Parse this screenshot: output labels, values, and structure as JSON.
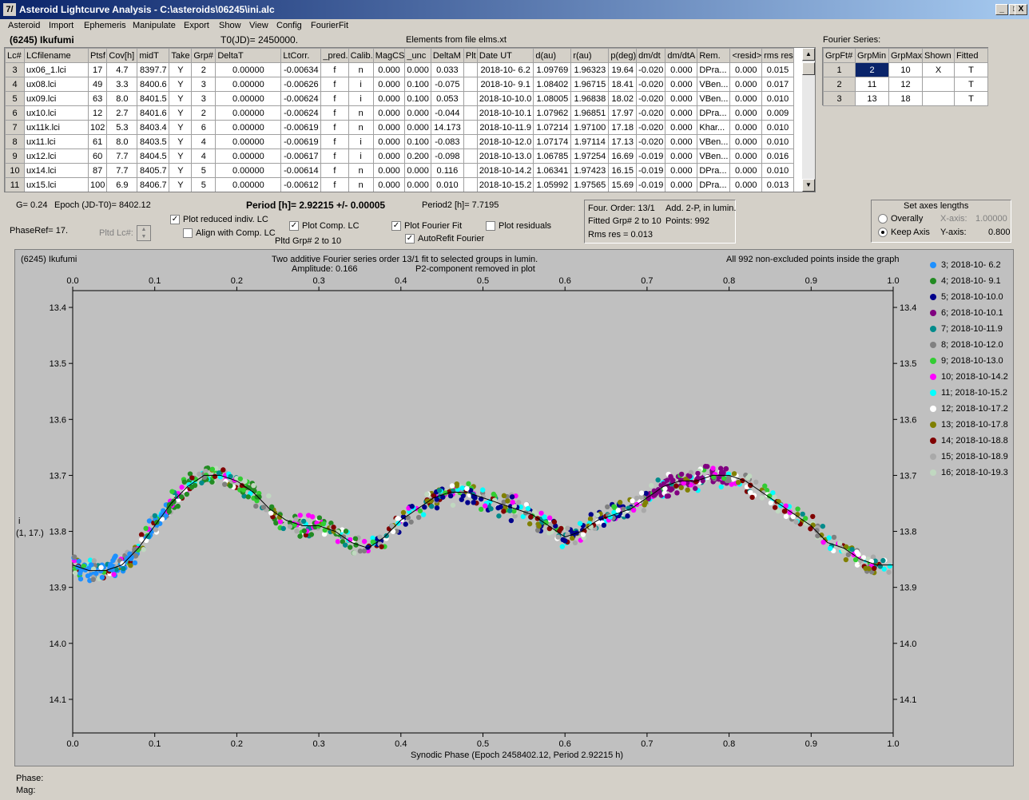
{
  "window": {
    "title": "Asteroid Lightcurve Analysis - C:\\asteroids\\06245\\ini.alc",
    "icon_text": "7/",
    "min": "_",
    "max": "□",
    "close": "X"
  },
  "menu": [
    "Asteroid",
    "Import",
    "Ephemeris",
    "Manipulate",
    "Export",
    "Show",
    "View",
    "Config",
    "FourierFit"
  ],
  "header": {
    "asteroid": "(6245) Ikufumi",
    "t0": "T0(JD)= 2450000.",
    "elements": "Elements from file elms.xt"
  },
  "grid": {
    "columns": [
      "Lc#",
      "LCfilename",
      "Ptsf",
      "Cov[h]",
      "midT",
      "Take",
      "Grp#",
      "DeltaT",
      "LtCorr.",
      "_pred.",
      "Calib.",
      "MagCS",
      "_unc",
      "DeltaM",
      "Plt",
      "Date UT",
      "d(au)",
      "r(au)",
      "p(deg)",
      "dm/dt",
      "dm/dtA",
      "Rem.",
      "<resid>",
      "rms res"
    ],
    "rows": [
      [
        "3",
        "ux06_1.lci",
        "17",
        "4.7",
        "8397.7",
        "Y",
        "2",
        "0.00000",
        "-0.00634",
        "f",
        "n",
        "0.000",
        "0.000",
        "0.033",
        "",
        "2018-10- 6.2",
        "1.09769",
        "1.96323",
        "19.64",
        "-0.020",
        "0.000",
        "DPra...",
        "0.000",
        "0.015"
      ],
      [
        "4",
        "ux08.lci",
        "49",
        "3.3",
        "8400.6",
        "Y",
        "3",
        "0.00000",
        "-0.00626",
        "f",
        "i",
        "0.000",
        "0.100",
        "-0.075",
        "",
        "2018-10- 9.1",
        "1.08402",
        "1.96715",
        "18.41",
        "-0.020",
        "0.000",
        "VBen...",
        "0.000",
        "0.017"
      ],
      [
        "5",
        "ux09.lci",
        "63",
        "8.0",
        "8401.5",
        "Y",
        "3",
        "0.00000",
        "-0.00624",
        "f",
        "i",
        "0.000",
        "0.100",
        "0.053",
        "",
        "2018-10-10.0",
        "1.08005",
        "1.96838",
        "18.02",
        "-0.020",
        "0.000",
        "VBen...",
        "0.000",
        "0.010"
      ],
      [
        "6",
        "ux10.lci",
        "12",
        "2.7",
        "8401.6",
        "Y",
        "2",
        "0.00000",
        "-0.00624",
        "f",
        "n",
        "0.000",
        "0.000",
        "-0.044",
        "",
        "2018-10-10.1",
        "1.07962",
        "1.96851",
        "17.97",
        "-0.020",
        "0.000",
        "DPra...",
        "0.000",
        "0.009"
      ],
      [
        "7",
        "ux11k.lci",
        "102",
        "5.3",
        "8403.4",
        "Y",
        "6",
        "0.00000",
        "-0.00619",
        "f",
        "n",
        "0.000",
        "0.000",
        "14.173",
        "",
        "2018-10-11.9",
        "1.07214",
        "1.97100",
        "17.18",
        "-0.020",
        "0.000",
        "Khar...",
        "0.000",
        "0.010"
      ],
      [
        "8",
        "ux11.lci",
        "61",
        "8.0",
        "8403.5",
        "Y",
        "4",
        "0.00000",
        "-0.00619",
        "f",
        "i",
        "0.000",
        "0.100",
        "-0.083",
        "",
        "2018-10-12.0",
        "1.07174",
        "1.97114",
        "17.13",
        "-0.020",
        "0.000",
        "VBen...",
        "0.000",
        "0.010"
      ],
      [
        "9",
        "ux12.lci",
        "60",
        "7.7",
        "8404.5",
        "Y",
        "4",
        "0.00000",
        "-0.00617",
        "f",
        "i",
        "0.000",
        "0.200",
        "-0.098",
        "",
        "2018-10-13.0",
        "1.06785",
        "1.97254",
        "16.69",
        "-0.019",
        "0.000",
        "VBen...",
        "0.000",
        "0.016"
      ],
      [
        "10",
        "ux14.lci",
        "87",
        "7.7",
        "8405.7",
        "Y",
        "5",
        "0.00000",
        "-0.00614",
        "f",
        "n",
        "0.000",
        "0.000",
        "0.116",
        "",
        "2018-10-14.2",
        "1.06341",
        "1.97423",
        "16.15",
        "-0.019",
        "0.000",
        "DPra...",
        "0.000",
        "0.010"
      ],
      [
        "11",
        "ux15.lci",
        "100",
        "6.9",
        "8406.7",
        "Y",
        "5",
        "0.00000",
        "-0.00612",
        "f",
        "n",
        "0.000",
        "0.000",
        "0.010",
        "",
        "2018-10-15.2",
        "1.05992",
        "1.97565",
        "15.69",
        "-0.019",
        "0.000",
        "DPra...",
        "0.000",
        "0.013"
      ]
    ]
  },
  "fourier": {
    "title": "Fourier Series:",
    "columns": [
      "GrpFt#",
      "GrpMin",
      "GrpMax",
      "Shown",
      "Fitted"
    ],
    "rows": [
      [
        "1",
        "2",
        "10",
        "X",
        "T"
      ],
      [
        "2",
        "11",
        "12",
        "",
        "T"
      ],
      [
        "3",
        "13",
        "18",
        "",
        "T"
      ]
    ]
  },
  "controls": {
    "g": "G= 0.24",
    "epoch": "Epoch (JD-T0)= 8402.12",
    "phase_ref": "PhaseRef= 17.",
    "pltd_lc": "Pltd Lc#:",
    "period": "Period [h]= 2.92215 +/- 0.00005",
    "period2": "Period2 [h]= 7.7195",
    "plot_reduced": "Plot reduced indiv. LC",
    "align": "Align with Comp. LC",
    "plot_comp": "Plot Comp. LC",
    "pltd_grp": "Pltd Grp#  2   to   10",
    "plot_fourier": "Plot Fourier Fit",
    "autorefit": "AutoRefit Fourier",
    "plot_residuals": "Plot residuals",
    "plot_reduced_checked": true,
    "align_checked": false,
    "plot_comp_checked": true,
    "plot_fourier_checked": true,
    "autorefit_checked": true,
    "plot_residuals_checked": false,
    "info1": "Four. Order: 13/1",
    "info2": "Add. 2-P, in lumin.",
    "info3": "Fitted Grp# 2 to 10",
    "info4": "Points: 992",
    "info5": "Rms res     = 0.013",
    "axes_title": "Set axes lengths",
    "overally": "Overally",
    "keep_axis": "Keep Axis",
    "xaxis_lbl": "X-axis:",
    "xaxis_val": "1.00000",
    "yaxis_lbl": "Y-axis:",
    "yaxis_val": "0.800",
    "keep_axis_selected": true
  },
  "plot": {
    "name": "(6245) Ikufumi",
    "line1": "Two additive Fourier series order 13/1 fit to selected groups in lumin.",
    "amp": "Amplitude: 0.166",
    "p2": "P2-component removed in plot",
    "allpts": "All 992 non-excluded points inside the graph",
    "ylabel1": "i",
    "ylabel2": "(1, 17.)",
    "xlabel": "Synodic Phase (Epoch 2458402.12, Period 2.92215 h)"
  },
  "footer": {
    "phase": "Phase:",
    "mag": "Mag:"
  },
  "chart_data": {
    "type": "scatter",
    "title": "Two additive Fourier series order 13/1 fit to selected groups in lumin.",
    "xlabel": "Synodic Phase (Epoch 2458402.12, Period 2.92215 h)",
    "ylabel": "i",
    "xlim": [
      0,
      1
    ],
    "ylim": [
      14.2,
      13.35
    ],
    "xticks": [
      "0.0",
      "0.1",
      "0.2",
      "0.3",
      "0.4",
      "0.5",
      "0.6",
      "0.7",
      "0.8",
      "0.9",
      "1.0"
    ],
    "yticks": [
      "13.4",
      "13.5",
      "13.6",
      "13.7",
      "13.8",
      "13.9",
      "14.0",
      "14.1"
    ],
    "fit_curve": {
      "x": [
        0,
        0.02,
        0.04,
        0.06,
        0.08,
        0.1,
        0.12,
        0.14,
        0.16,
        0.18,
        0.2,
        0.22,
        0.24,
        0.26,
        0.28,
        0.3,
        0.32,
        0.34,
        0.36,
        0.38,
        0.4,
        0.42,
        0.44,
        0.46,
        0.48,
        0.5,
        0.52,
        0.54,
        0.56,
        0.58,
        0.6,
        0.62,
        0.64,
        0.66,
        0.68,
        0.7,
        0.72,
        0.74,
        0.76,
        0.78,
        0.8,
        0.82,
        0.84,
        0.86,
        0.88,
        0.9,
        0.92,
        0.94,
        0.96,
        0.98,
        1.0
      ],
      "y": [
        13.86,
        13.87,
        13.87,
        13.86,
        13.83,
        13.79,
        13.75,
        13.72,
        13.7,
        13.7,
        13.71,
        13.73,
        13.76,
        13.78,
        13.79,
        13.79,
        13.8,
        13.82,
        13.83,
        13.81,
        13.78,
        13.76,
        13.74,
        13.73,
        13.73,
        13.74,
        13.75,
        13.76,
        13.77,
        13.79,
        13.81,
        13.8,
        13.78,
        13.77,
        13.76,
        13.74,
        13.72,
        13.71,
        13.71,
        13.7,
        13.7,
        13.71,
        13.73,
        13.75,
        13.77,
        13.79,
        13.82,
        13.83,
        13.85,
        13.86,
        13.86
      ]
    },
    "series": [
      {
        "name": "3; 2018-10- 6.2",
        "color": "#1e90ff",
        "phase_range": [
          0.0,
          0.12
        ]
      },
      {
        "name": "4; 2018-10- 9.1",
        "color": "#228b22",
        "phase_range": [
          0.1,
          0.35
        ]
      },
      {
        "name": "5; 2018-10-10.0",
        "color": "#00008b",
        "phase_range": [
          0.35,
          0.7
        ]
      },
      {
        "name": "6; 2018-10-10.1",
        "color": "#800080",
        "phase_range": [
          0.7,
          0.8
        ]
      },
      {
        "name": "7; 2018-10-11.9",
        "color": "#008b8b",
        "phase_range": [
          0.0,
          1.0
        ]
      },
      {
        "name": "8; 2018-10-12.0",
        "color": "#808080",
        "phase_range": [
          0.0,
          1.0
        ]
      },
      {
        "name": "9; 2018-10-13.0",
        "color": "#32cd32",
        "phase_range": [
          0.0,
          1.0
        ]
      },
      {
        "name": "10; 2018-10-14.2",
        "color": "#ff00ff",
        "phase_range": [
          0.0,
          1.0
        ]
      },
      {
        "name": "11; 2018-10-15.2",
        "color": "#00ffff",
        "phase_range": [
          0.0,
          1.0
        ]
      },
      {
        "name": "12; 2018-10-17.2",
        "color": "#ffffff",
        "phase_range": [
          0.0,
          1.0
        ]
      },
      {
        "name": "13; 2018-10-17.8",
        "color": "#808000",
        "phase_range": [
          0.0,
          1.0
        ]
      },
      {
        "name": "14; 2018-10-18.8",
        "color": "#800000",
        "phase_range": [
          0.0,
          1.0
        ]
      },
      {
        "name": "15; 2018-10-18.9",
        "color": "#a9a9a9",
        "phase_range": [
          0.0,
          1.0
        ]
      },
      {
        "name": "16; 2018-10-19.3",
        "color": "#c0d8c0",
        "phase_range": [
          0.0,
          1.0
        ]
      }
    ],
    "points_count": 992
  }
}
